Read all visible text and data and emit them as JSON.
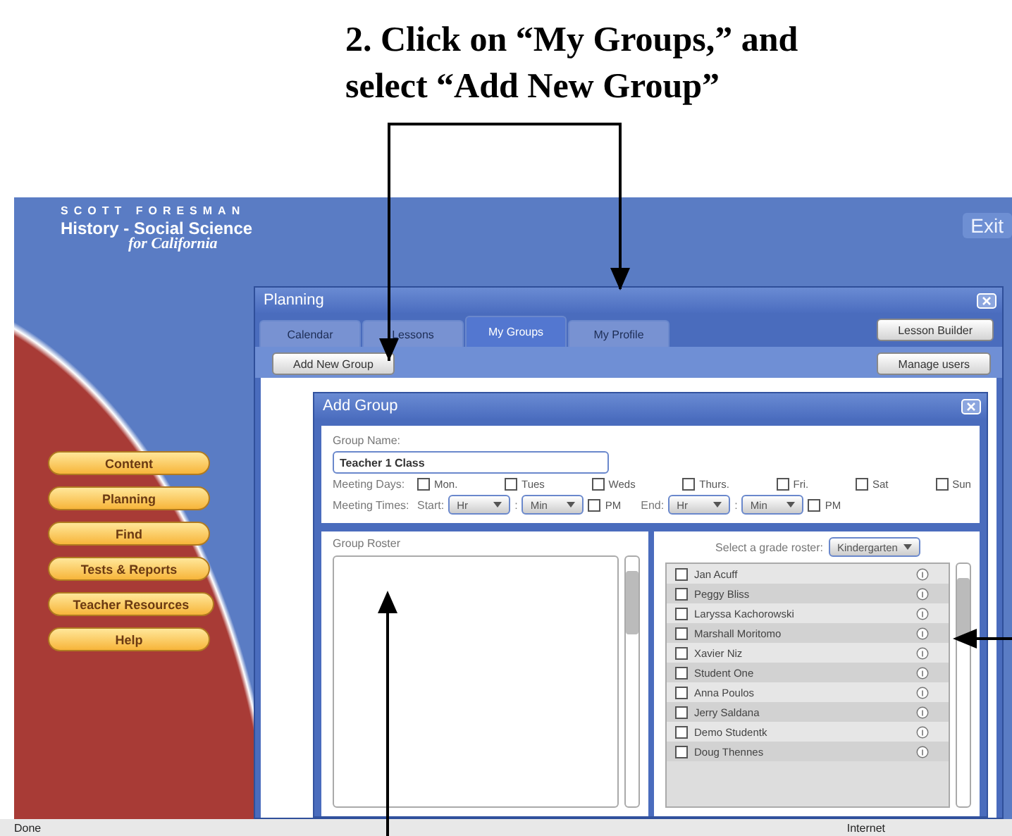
{
  "caption": {
    "lines": [
      "2. Click on “My Groups,” and",
      "select “Add New Group”"
    ]
  },
  "header": {
    "brand": "SCOTT FORESMAN",
    "title": "History - Social Science",
    "subtitle": "for California",
    "exit": "Exit"
  },
  "nav": [
    "Content",
    "Planning",
    "Find",
    "Tests & Reports",
    "Teacher Resources",
    "Help"
  ],
  "planning": {
    "title": "Planning",
    "tabs": [
      {
        "label": "Calendar",
        "selected": false
      },
      {
        "label": "Lessons",
        "selected": false
      },
      {
        "label": "My Groups",
        "selected": true
      },
      {
        "label": "My Profile",
        "selected": false
      }
    ],
    "lesson_builder": "Lesson Builder",
    "add_new_group": "Add New Group",
    "manage_users": "Manage users"
  },
  "dialog": {
    "title": "Add Group",
    "group_name_label": "Group Name:",
    "group_name": "Teacher 1 Class",
    "meeting_days_label": "Meeting Days:",
    "days": [
      {
        "label": "Mon.",
        "checked": false
      },
      {
        "label": "Tues",
        "checked": false
      },
      {
        "label": "Weds",
        "checked": false
      },
      {
        "label": "Thurs.",
        "checked": false
      },
      {
        "label": "Fri.",
        "checked": false
      },
      {
        "label": "Sat",
        "checked": false
      },
      {
        "label": "Sun",
        "checked": false
      }
    ],
    "meeting_times_label": "Meeting Times:",
    "times": [
      {
        "label": "Start:",
        "hour": "Hr",
        "separator": ":",
        "minute": "Min",
        "pm_label": "PM",
        "pm": false
      },
      {
        "label": "End:",
        "hour": "Hr",
        "separator": ":",
        "minute": "Min",
        "pm_label": "PM",
        "pm": false
      }
    ],
    "roster_label": "Group Roster",
    "grade_label": "Select a grade roster:",
    "grade": "Kindergarten",
    "students": [
      {
        "name": "Jan Acuff",
        "checked": false
      },
      {
        "name": "Peggy Bliss",
        "checked": false
      },
      {
        "name": "Laryssa Kachorowski",
        "checked": false
      },
      {
        "name": "Marshall Moritomo",
        "checked": false
      },
      {
        "name": "Xavier Niz",
        "checked": false
      },
      {
        "name": "Student One",
        "checked": false
      },
      {
        "name": "Anna Poulos",
        "checked": false
      },
      {
        "name": "Jerry Saldana",
        "checked": false
      },
      {
        "name": "Demo Studentk",
        "checked": false
      },
      {
        "name": "Doug Thennes",
        "checked": false
      }
    ]
  },
  "status_bar": {
    "left": "Done",
    "right": "Internet"
  }
}
